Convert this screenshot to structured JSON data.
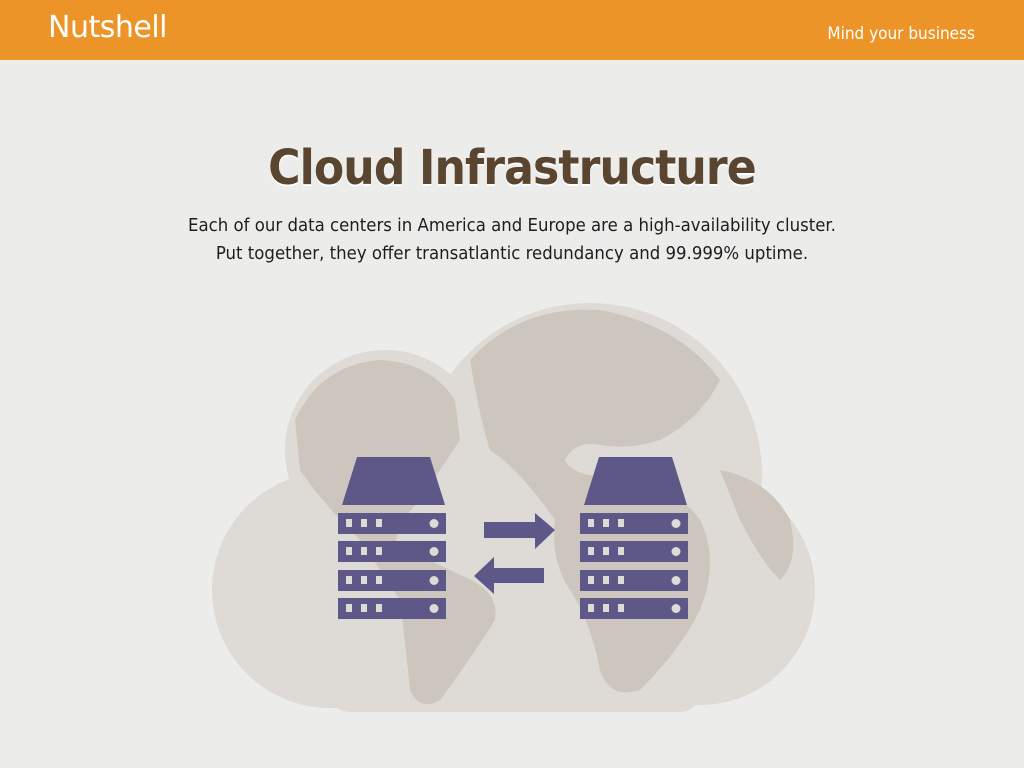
{
  "header": {
    "logo": "Nutshell",
    "tagline": "Mind your business"
  },
  "main": {
    "title": "Cloud Infrastructure",
    "description": [
      "Each of our data centers in America and Europe are a high-availability cluster.",
      "Put together, they offer transatlantic redundancy and 99.999% uptime."
    ]
  },
  "illustration": {
    "icons": [
      "cloud-icon",
      "world-map-icon",
      "server-icon",
      "arrow-right-icon",
      "arrow-left-icon",
      "server-icon"
    ],
    "colors": {
      "header": "#ec9428",
      "title": "#5a4630",
      "server": "#5e5889",
      "cloud": "#dedad5",
      "land": "#cdc6bf"
    }
  }
}
